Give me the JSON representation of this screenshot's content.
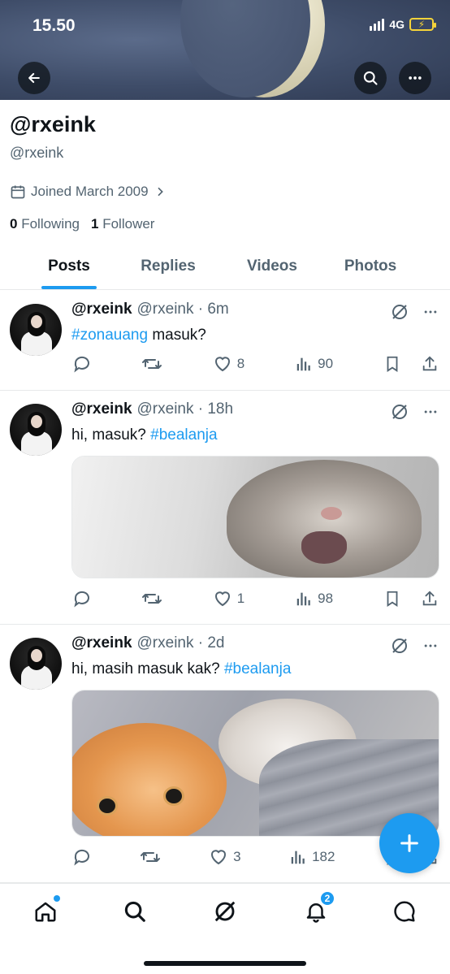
{
  "status_bar": {
    "time": "15.50",
    "network": "4G"
  },
  "profile": {
    "display_name": "@rxeink",
    "handle": "@rxeink",
    "joined": "Joined March 2009",
    "following_count": "0",
    "following_label": "Following",
    "followers_count": "1",
    "followers_label": "Follower"
  },
  "tabs": [
    {
      "label": "Posts",
      "active": true
    },
    {
      "label": "Replies"
    },
    {
      "label": "Videos"
    },
    {
      "label": "Photos"
    }
  ],
  "posts": [
    {
      "name": "@rxeink",
      "meta": "@rxeink · 6m",
      "hashtag": "#zonauang",
      "text_after": " masuk?",
      "text_before": "",
      "replies": "",
      "reposts": "",
      "likes": "8",
      "views": "90"
    },
    {
      "name": "@rxeink",
      "meta": "@rxeink · 18h",
      "text_before": "hi, masuk? ",
      "hashtag": "#bealanja",
      "text_after": "",
      "replies": "",
      "reposts": "",
      "likes": "1",
      "views": "98"
    },
    {
      "name": "@rxeink",
      "meta": "@rxeink · 2d",
      "text_before": "hi, masih masuk kak? ",
      "hashtag": "#bealanja",
      "text_after": "",
      "replies": "",
      "reposts": "",
      "likes": "3",
      "views": "182"
    }
  ],
  "bottom_nav": {
    "notifications_badge": "2",
    "items": [
      "home-icon",
      "search-icon",
      "grok-icon",
      "notifications-icon",
      "messages-icon"
    ]
  },
  "colors": {
    "accent": "#1d9bf0",
    "text": "#0f1419",
    "muted": "#536471"
  }
}
